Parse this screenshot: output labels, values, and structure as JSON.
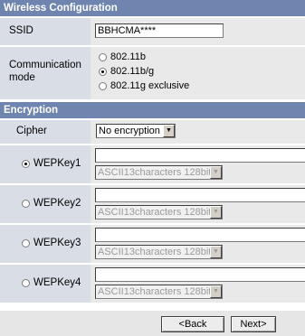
{
  "wireless": {
    "header": "Wireless Configuration",
    "ssid_label": "SSID",
    "ssid_value": "BBHCMA****",
    "mode_label_1": "Communication",
    "mode_label_2": "mode",
    "modes": [
      "802.11b",
      "802.11b/g",
      "802.11g exclusive"
    ],
    "selected_mode": "802.11b/g"
  },
  "encryption": {
    "header": "Encryption",
    "cipher_label": "Cipher",
    "cipher_value": "No encryption",
    "keys": [
      {
        "label": "WEPKey1",
        "type": "ASCII13characters 128bit",
        "selected": true
      },
      {
        "label": "WEPKey2",
        "type": "ASCII13characters 128bit",
        "selected": false
      },
      {
        "label": "WEPKey3",
        "type": "ASCII13characters 128bit",
        "selected": false
      },
      {
        "label": "WEPKey4",
        "type": "ASCII13characters 128bit",
        "selected": false
      }
    ]
  },
  "nav": {
    "back_label": "<Back",
    "next_label": "Next>"
  },
  "colors": {
    "header_bg": "#6f84ae",
    "label_bg": "#d9dde6",
    "value_bg": "#e9e9e9"
  },
  "icons": {
    "dropdown": "chevron-down-icon",
    "radio": "radio-icon"
  }
}
